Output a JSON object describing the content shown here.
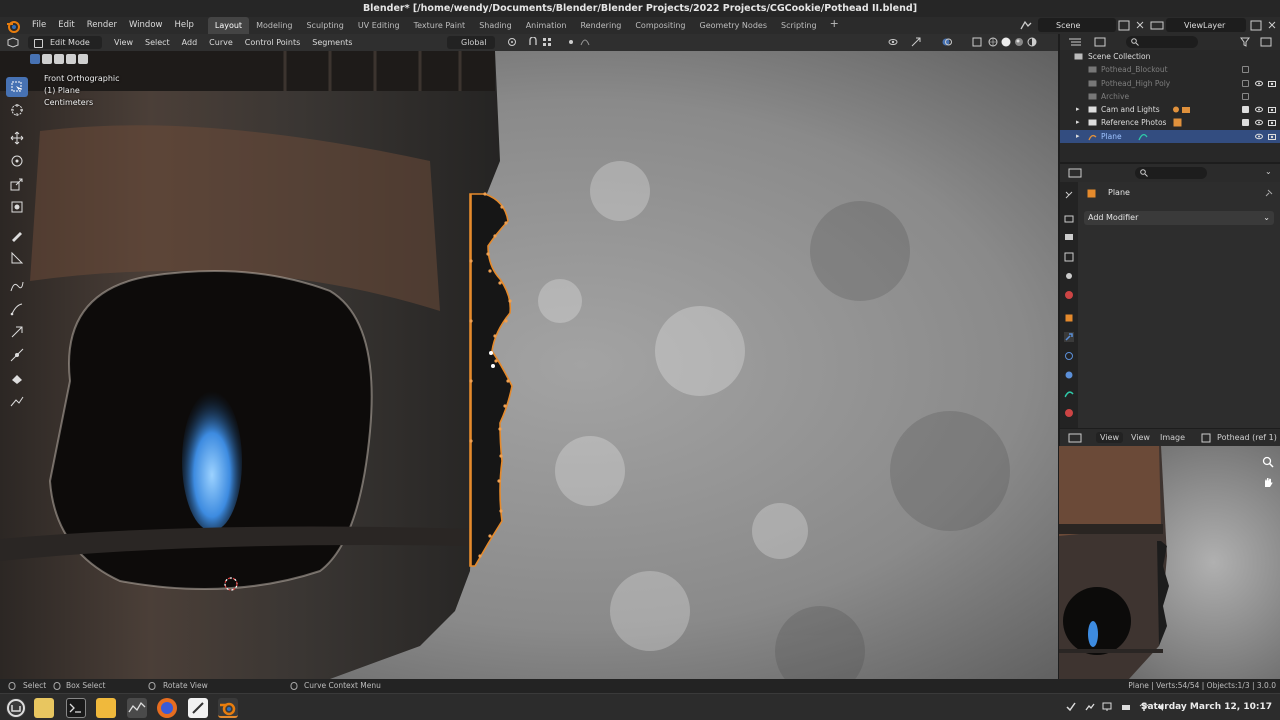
{
  "window": {
    "title": "Blender* [/home/wendy/Documents/Blender/Blender Projects/2022 Projects/CGCookie/Pothead II.blend]"
  },
  "topbar": {
    "menus": [
      "File",
      "Edit",
      "Render",
      "Window",
      "Help"
    ],
    "workspaces": [
      "Layout",
      "Modeling",
      "Sculpting",
      "UV Editing",
      "Texture Paint",
      "Shading",
      "Animation",
      "Rendering",
      "Compositing",
      "Geometry Nodes",
      "Scripting"
    ],
    "active_workspace": "Layout",
    "add_workspace": "+",
    "scene": "Scene",
    "view_layer": "ViewLayer"
  },
  "viewport_header": {
    "mode": "Edit Mode",
    "menus": [
      "View",
      "Select",
      "Add",
      "Curve",
      "Control Points",
      "Segments"
    ],
    "orientation": "Global"
  },
  "viewport": {
    "view_name": "Front Orthographic",
    "object": "(1) Plane",
    "units": "Centimeters"
  },
  "outliner": {
    "search_placeholder": "",
    "root": "Scene Collection",
    "items": [
      {
        "label": "Pothead_Blockout",
        "checked": false,
        "dim": true,
        "visible": false
      },
      {
        "label": "Pothead_High Poly",
        "checked": false,
        "dim": true,
        "visible": true
      },
      {
        "label": "Archive",
        "checked": false,
        "dim": true,
        "visible": false
      },
      {
        "label": "Cam and Lights",
        "checked": true,
        "dim": false,
        "visible": true
      },
      {
        "label": "Reference Photos",
        "checked": true,
        "dim": false,
        "visible": true
      },
      {
        "label": "Plane",
        "checked": false,
        "dim": false,
        "visible": true,
        "selected": true
      }
    ]
  },
  "properties": {
    "search_placeholder": "",
    "object_name": "Plane",
    "add_modifier": "Add Modifier"
  },
  "image_editor": {
    "view": "View",
    "view2": "View",
    "image_menu": "Image",
    "image_name": "Pothead (ref 1)"
  },
  "statusbar": {
    "select": "Select",
    "box_select": "Box Select",
    "rotate_view": "Rotate View",
    "context_menu": "Curve Context Menu",
    "stats": "Plane | Verts:54/54 | Objects:1/3 | 3.0.0"
  },
  "taskbar": {
    "clock": "Saturday March 12, 10:17",
    "apps": [
      "menu-icon",
      "files-icon",
      "terminal-icon",
      "folder-icon",
      "monitor-icon",
      "firefox-icon",
      "editor-icon",
      "blender-icon"
    ]
  },
  "colors": {
    "accent": "#4772b3",
    "selection": "#334d80",
    "curve": "#e58a2c",
    "flame": "#3d8be0"
  }
}
